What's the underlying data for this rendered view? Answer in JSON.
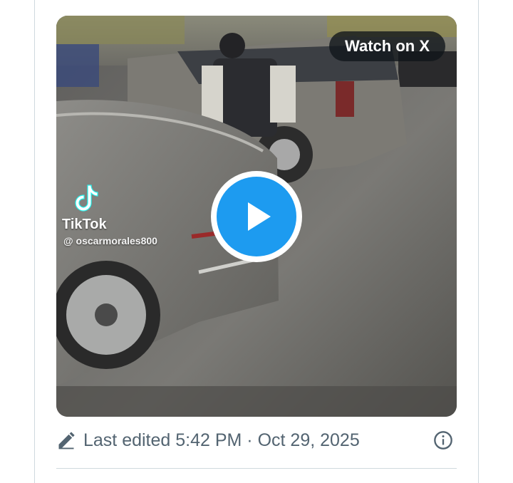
{
  "media": {
    "watch_label": "Watch on X",
    "watermark": {
      "app_name": "TikTok",
      "handle": "@ oscarmorales800"
    },
    "play_icon": "play-icon",
    "colors": {
      "play_blue": "#1d9bf0",
      "pill_bg": "#0f1419"
    }
  },
  "footer": {
    "edited_text": "Last edited 5:42 PM · Oct 29, 2025",
    "edit_icon": "pencil-icon",
    "info_icon": "info-icon",
    "text_color": "#536471"
  }
}
